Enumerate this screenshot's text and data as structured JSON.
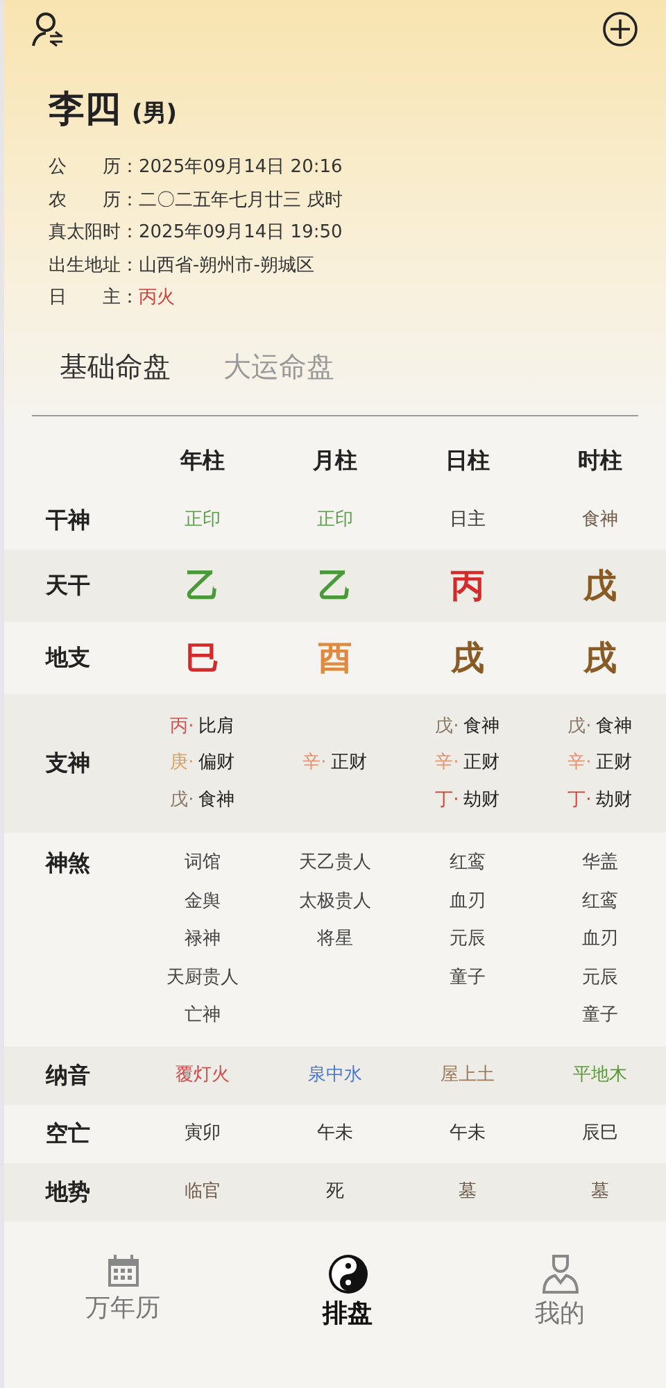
{
  "profile": {
    "name": "李四",
    "gender": "(男)"
  },
  "info": [
    {
      "label": "公　　历：",
      "value": "2025年09月14日 20:16"
    },
    {
      "label": "农　　历：",
      "value": "二〇二五年七月廿三 戌时"
    },
    {
      "label": "真太阳时：",
      "value": "2025年09月14日 19:50"
    },
    {
      "label": "出生地址：",
      "value": "山西省-朔州市-朔城区"
    },
    {
      "label": "日　　主：",
      "value": "丙火",
      "color": "#d43b3b"
    }
  ],
  "tabs": [
    {
      "label": "基础命盘",
      "selected": true
    },
    {
      "label": "大运命盘",
      "selected": false
    }
  ],
  "table": {
    "columns": [
      "年柱",
      "月柱",
      "日柱",
      "时柱"
    ],
    "rows": [
      {
        "label": "干神",
        "kind": "text",
        "cells": [
          {
            "text": "正印",
            "color": "#5e9a4e"
          },
          {
            "text": "正印",
            "color": "#5e9a4e"
          },
          {
            "text": "日主",
            "color": "#333333"
          },
          {
            "text": "食神",
            "color": "#6e5a48"
          }
        ]
      },
      {
        "label": "天干",
        "kind": "big",
        "cells": [
          {
            "text": "乙",
            "color": "#4a9a3c"
          },
          {
            "text": "乙",
            "color": "#4a9a3c"
          },
          {
            "text": "丙",
            "color": "#d42a2a"
          },
          {
            "text": "戊",
            "color": "#8a5a24"
          }
        ]
      },
      {
        "label": "地支",
        "kind": "big",
        "cells": [
          {
            "text": "巳",
            "color": "#d42a2a"
          },
          {
            "text": "酉",
            "color": "#e08a40"
          },
          {
            "text": "戌",
            "color": "#8a5a24"
          },
          {
            "text": "戌",
            "color": "#8a5a24"
          }
        ]
      },
      {
        "label": "支神",
        "kind": "hidden",
        "cells": [
          [
            {
              "stem": "丙·",
              "color": "#d45050",
              "god": "比肩"
            },
            {
              "stem": "庚·",
              "color": "#e0a060",
              "god": "偏财"
            },
            {
              "stem": "戊·",
              "color": "#8a7a6a",
              "god": "食神"
            }
          ],
          [
            {
              "stem": "辛·",
              "color": "#e59070",
              "god": "正财"
            }
          ],
          [
            {
              "stem": "戊·",
              "color": "#8a7a6a",
              "god": "食神"
            },
            {
              "stem": "辛·",
              "color": "#e59070",
              "god": "正财"
            },
            {
              "stem": "丁·",
              "color": "#d04030",
              "god": "劫财"
            }
          ],
          [
            {
              "stem": "戊·",
              "color": "#8a7a6a",
              "god": "食神"
            },
            {
              "stem": "辛·",
              "color": "#e59070",
              "god": "正财"
            },
            {
              "stem": "丁·",
              "color": "#d04030",
              "god": "劫财"
            }
          ]
        ]
      },
      {
        "label": "神煞",
        "kind": "list",
        "cells": [
          [
            "词馆",
            "金舆",
            "禄神",
            "天厨贵人",
            "亡神"
          ],
          [
            "天乙贵人",
            "太极贵人",
            "将星"
          ],
          [
            "红鸾",
            "血刃",
            "元辰",
            "童子"
          ],
          [
            "华盖",
            "红鸾",
            "血刃",
            "元辰",
            "童子"
          ]
        ]
      },
      {
        "label": "纳音",
        "kind": "text",
        "cells": [
          {
            "text": "覆灯火",
            "color": "#d44a4a"
          },
          {
            "text": "泉中水",
            "color": "#4a78d4"
          },
          {
            "text": "屋上土",
            "color": "#9a7a5a"
          },
          {
            "text": "平地木",
            "color": "#5a9a3a"
          }
        ]
      },
      {
        "label": "空亡",
        "kind": "text",
        "cells": [
          {
            "text": "寅卯",
            "color": "#333333"
          },
          {
            "text": "午未",
            "color": "#333333"
          },
          {
            "text": "午未",
            "color": "#333333"
          },
          {
            "text": "辰巳",
            "color": "#333333"
          }
        ]
      },
      {
        "label": "地势",
        "kind": "text",
        "cells": [
          {
            "text": "临官",
            "color": "#6e5a48"
          },
          {
            "text": "死",
            "color": "#333333"
          },
          {
            "text": "墓",
            "color": "#6e5a48"
          },
          {
            "text": "墓",
            "color": "#6e5a48"
          }
        ]
      }
    ]
  },
  "nav": [
    {
      "label": "万年历",
      "kind": "calendar",
      "selected": false
    },
    {
      "label": "排盘",
      "kind": "yinyang",
      "selected": true
    },
    {
      "label": "我的",
      "kind": "person",
      "selected": false
    }
  ]
}
